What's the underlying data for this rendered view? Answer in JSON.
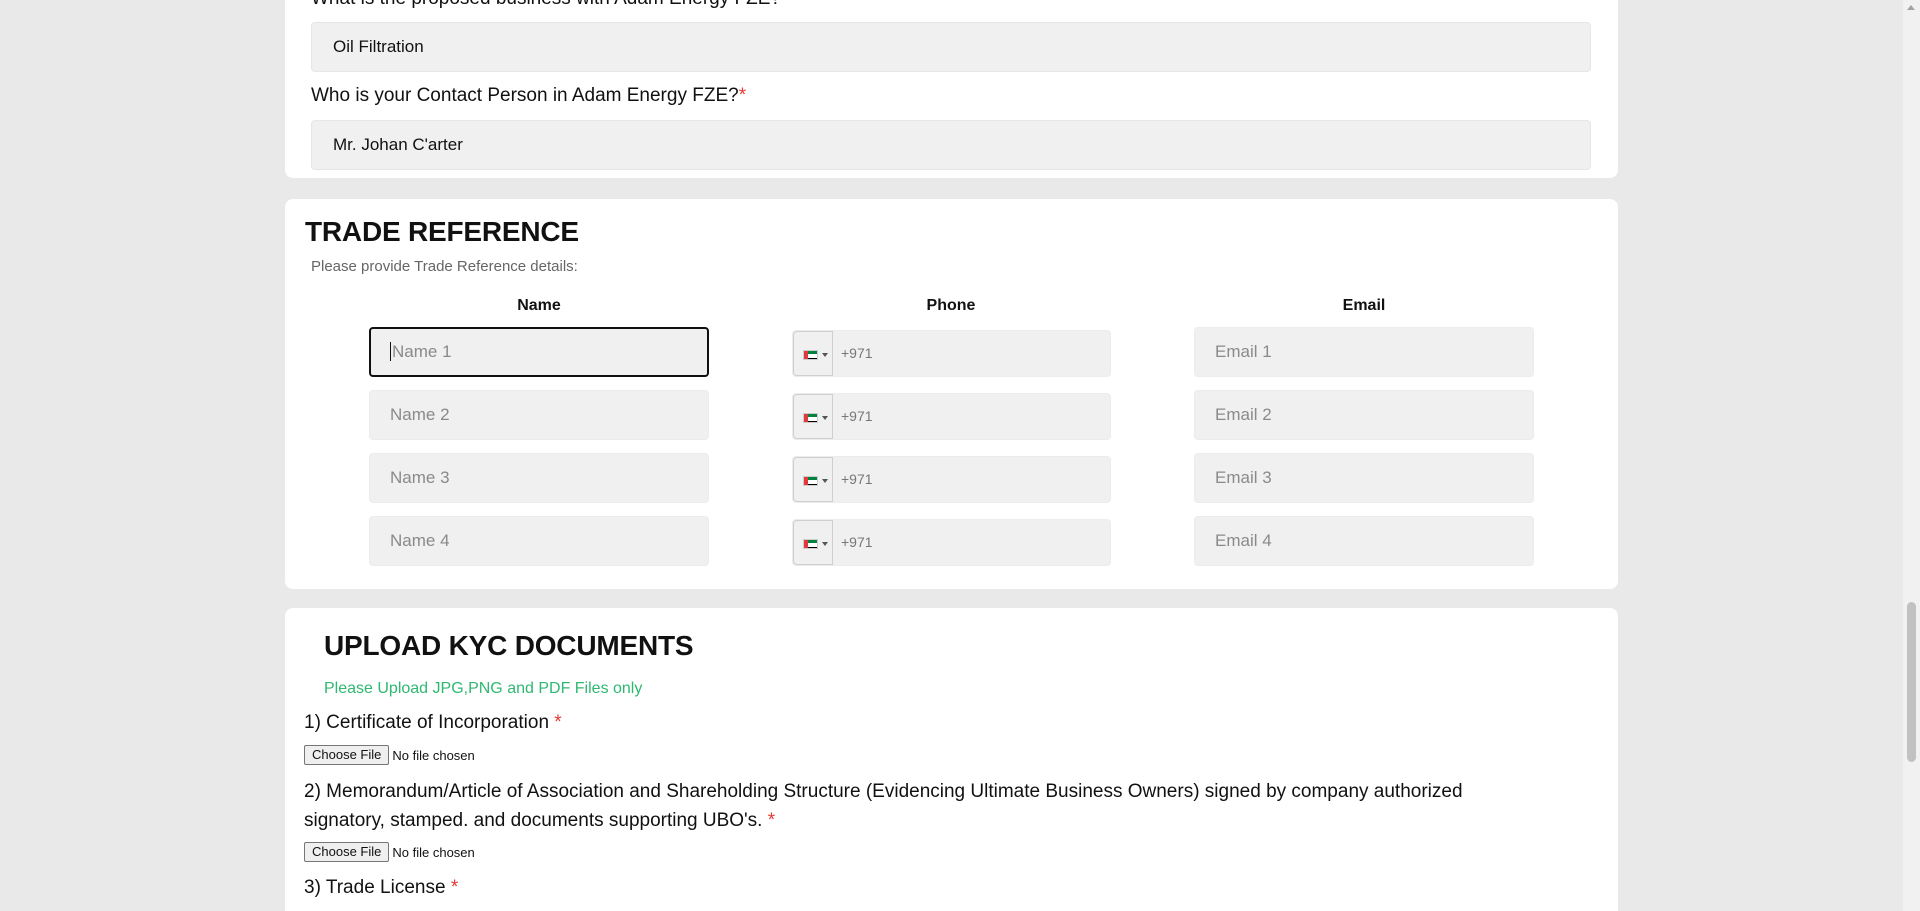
{
  "business": {
    "question_proposed": "What is the proposed business with Adam Energy FZE?",
    "proposed_value": "Oil Filtration",
    "question_contact": "Who is your Contact Person in Adam Energy FZE?",
    "required_mark": "*",
    "contact_value": "Mr. Johan C'arter"
  },
  "trade_reference": {
    "title": "TRADE REFERENCE",
    "subtitle": "Please provide Trade Reference details:",
    "columns": {
      "name": "Name",
      "phone": "Phone",
      "email": "Email"
    },
    "rows": [
      {
        "name_placeholder": "Name 1",
        "phone_value": "+971",
        "email_placeholder": "Email 1"
      },
      {
        "name_placeholder": "Name 2",
        "phone_value": "+971",
        "email_placeholder": "Email 2"
      },
      {
        "name_placeholder": "Name 3",
        "phone_value": "+971",
        "email_placeholder": "Email 3"
      },
      {
        "name_placeholder": "Name 4",
        "phone_value": "+971",
        "email_placeholder": "Email 4"
      }
    ],
    "flag_icon": "uae-flag-icon"
  },
  "kyc": {
    "title": "UPLOAD KYC DOCUMENTS",
    "note": "Please Upload JPG,PNG and PDF Files only",
    "documents": [
      {
        "label": "1) Certificate of Incorporation",
        "button": "Choose File",
        "status": "No file chosen"
      },
      {
        "label": "2) Memorandum/Article of Association and Shareholding Structure (Evidencing Ultimate Business Owners) signed by company authorized signatory, stamped. and documents supporting UBO's.",
        "button": "Choose File",
        "status": "No file chosen"
      },
      {
        "label": "3) Trade License"
      }
    ],
    "required_mark": "*"
  },
  "colors": {
    "background": "#e9e9e9",
    "card": "#ffffff",
    "required": "#e53935",
    "note_green": "#2fb872"
  }
}
